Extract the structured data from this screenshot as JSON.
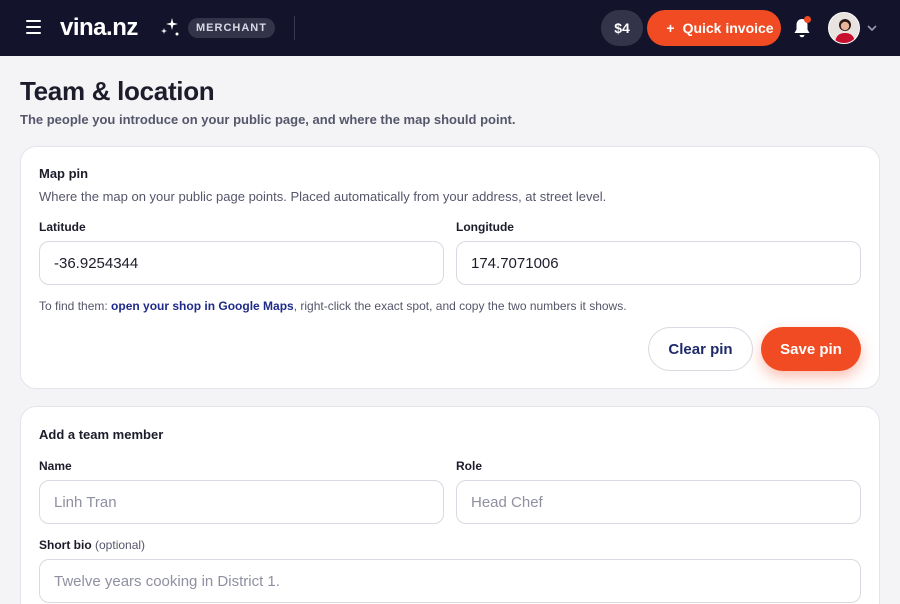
{
  "topbar": {
    "logo_text": "vina.nz",
    "badge": "MERCHANT",
    "balance": "$4",
    "quick_invoice_label": "Quick invoice",
    "accent_color": "#f04b22",
    "bg_color": "#13132b",
    "icons": [
      "menu-icon",
      "sparkle-icon",
      "plus-icon",
      "bell-icon",
      "avatar",
      "chevron-down-icon"
    ]
  },
  "page": {
    "title": "Team & location",
    "subtitle": "The people you introduce on your public page, and where the map should point."
  },
  "map_pin": {
    "title": "Map pin",
    "description": "Where the map on your public page points. Placed automatically from your address, at street level.",
    "latitude_label": "Latitude",
    "latitude_value": "-36.9254344",
    "longitude_label": "Longitude",
    "longitude_value": "174.7071006",
    "hint_prefix": "To find them: ",
    "hint_link": "open your shop in Google Maps",
    "hint_suffix": ", right-click the exact spot, and copy the two numbers it shows.",
    "clear_label": "Clear pin",
    "save_label": "Save pin"
  },
  "team": {
    "title": "Add a team member",
    "name_label": "Name",
    "name_placeholder": "Linh Tran",
    "role_label": "Role",
    "role_placeholder": "Head Chef",
    "bio_label": "Short bio",
    "bio_optional": "(optional)",
    "bio_placeholder": "Twelve years cooking in District 1."
  }
}
